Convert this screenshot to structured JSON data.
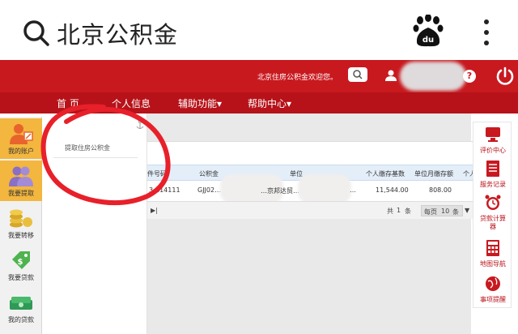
{
  "search": {
    "query": "北京公积金"
  },
  "header": {
    "welcome": "北京住房公积金欢迎您。"
  },
  "nav": {
    "items": [
      "首 页",
      "个人信息",
      "辅助功能▾",
      "帮助中心▾"
    ]
  },
  "sidebar": {
    "items": [
      "我的账户",
      "我要提取",
      "我要转移",
      "我要贷款",
      "我的贷款"
    ]
  },
  "dropdown": {
    "item": "提取住房公积金"
  },
  "table": {
    "headers": [
      "件号码",
      "公积金",
      "单位",
      "个人缴存基数",
      "单位月缴存额",
      "个人"
    ],
    "row": [
      "3…14111",
      "GJJ02…",
      "…京邦达贸…",
      "…",
      "11,544.00",
      "808.00"
    ]
  },
  "pager": {
    "total_prefix": "共",
    "total_count": "1",
    "total_suffix": "条",
    "per_page_label": "每页",
    "per_page_value": "10",
    "unit": "条"
  },
  "rightbar": {
    "items": [
      "评价中心",
      "服务记录",
      "贷款计算器",
      "地图导航",
      "事项提醒"
    ]
  },
  "colors": {
    "brand_red": "#c8191f",
    "active_yellow": "#f3b63e",
    "scribble": "#e8202a"
  }
}
